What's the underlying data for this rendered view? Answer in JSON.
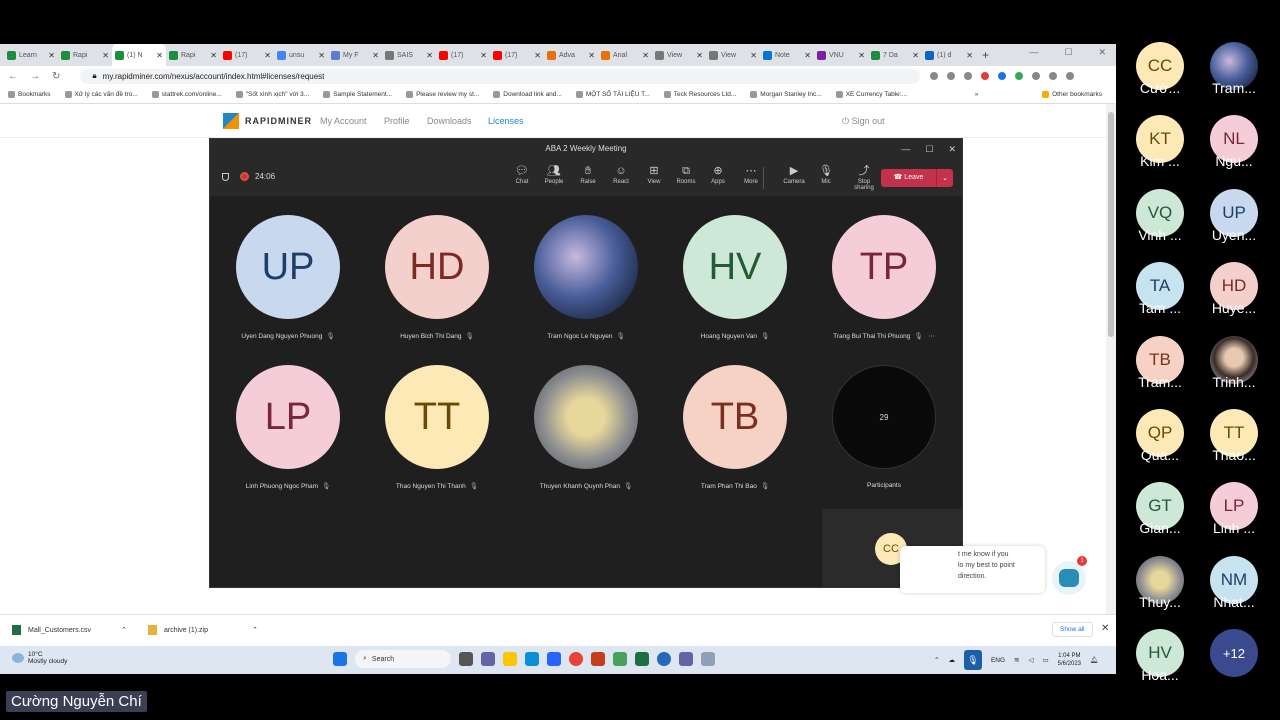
{
  "browser": {
    "tabs": [
      {
        "label": "Learn",
        "icon": "green"
      },
      {
        "label": "Rapi",
        "icon": "green"
      },
      {
        "label": "(1) N",
        "icon": "green",
        "active": true
      },
      {
        "label": "Rapi",
        "icon": "green"
      },
      {
        "label": "(17)",
        "icon": "youtube"
      },
      {
        "label": "unsu",
        "icon": "google"
      },
      {
        "label": "My F",
        "icon": "blue"
      },
      {
        "label": "SAIS",
        "icon": "gray"
      },
      {
        "label": "(17)",
        "icon": "youtube"
      },
      {
        "label": "(17)",
        "icon": "youtube"
      },
      {
        "label": "Adva",
        "icon": "orange"
      },
      {
        "label": "Anal",
        "icon": "orange"
      },
      {
        "label": "View",
        "icon": "gray"
      },
      {
        "label": "View",
        "icon": "gray"
      },
      {
        "label": "Note",
        "icon": "cloud"
      },
      {
        "label": "VNU",
        "icon": "purple"
      },
      {
        "label": "7 Da",
        "icon": "green"
      },
      {
        "label": "(1) d",
        "icon": "linkedin"
      }
    ],
    "new_tab": "+",
    "url": "my.rapidminer.com/nexus/account/index.html#licenses/request",
    "bookmarks": [
      "Bookmarks",
      "Xử lý các vấn đề tro...",
      "stattrek.com/online...",
      "\"Sốt xình xịch\" với 3...",
      "Sample Statement...",
      "Please review my st...",
      "Download link and...",
      "MỘT SỐ TÀI LIỆU T...",
      "Teck Resources Ltd...",
      "Morgan Stanley Inc...",
      "XE Currency Table:..."
    ],
    "more": "»",
    "other_bookmarks": "Other bookmarks"
  },
  "site": {
    "logo": "RAPIDMINER",
    "nav": [
      "My Account",
      "Profile",
      "Downloads",
      "Licenses"
    ],
    "signout": "Sign out"
  },
  "meeting": {
    "title": "ABA 2 Weekly Meeting",
    "timer": "24:06",
    "tools": [
      "Chat",
      "People",
      "Raise",
      "React",
      "View",
      "Rooms",
      "Apps",
      "More",
      "Camera",
      "Mic",
      "Stop sharing"
    ],
    "leave": "Leave",
    "participants": [
      {
        "initials": "UP",
        "name": "Uyen Dang Nguyen Phuong",
        "bg": "#c8d8ee",
        "fg": "#1e3e6a"
      },
      {
        "initials": "HD",
        "name": "Huyen Bich Thi Dang",
        "bg": "#f3d0cb",
        "fg": "#7a2a22"
      },
      {
        "initials": "",
        "name": "Tram Ngoc Le Nguyen",
        "bg": "photo-blue",
        "fg": "#fff"
      },
      {
        "initials": "HV",
        "name": "Hoang Nguyen Van",
        "bg": "#cde8d6",
        "fg": "#245a34"
      },
      {
        "initials": "TP",
        "name": "Trang Bui Thai Thi Phuong",
        "bg": "#f5cdd8",
        "fg": "#7a2540"
      },
      {
        "initials": "LP",
        "name": "Linh Phuong Ngoc Pham",
        "bg": "#f5cdd8",
        "fg": "#7a2540"
      },
      {
        "initials": "TT",
        "name": "Thao Nguyen Thi Thanh",
        "bg": "#fde9b6",
        "fg": "#6b4a00"
      },
      {
        "initials": "",
        "name": "Thuyen Khanh Quynh Phan",
        "bg": "photo-gray",
        "fg": "#fff"
      },
      {
        "initials": "TB",
        "name": "Tram Phan Thi Bao",
        "bg": "#f6d2c4",
        "fg": "#7a3020"
      },
      {
        "initials": "29",
        "name": "Participants",
        "bg": "#0a0a0a",
        "fg": "#ddd"
      }
    ],
    "self_initials": "CC"
  },
  "chatbot": {
    "line1": "t me know if you",
    "line2": "lo my best to point",
    "line3": "direction.",
    "badge": "1"
  },
  "downloads": {
    "items": [
      "Mall_Customers.csv",
      "archive (1).zip"
    ],
    "show_all": "Show all",
    "close": "✕"
  },
  "taskbar": {
    "temp": "10°C",
    "weather": "Mostly cloudy",
    "search": "Search",
    "lang": "ENG",
    "time": "1:04 PM",
    "date": "5/6/2023"
  },
  "gallery": [
    {
      "initials": "CC",
      "name": "Cườ...",
      "bg": "#fde9b6",
      "fg": "#6b4a00"
    },
    {
      "initials": "",
      "name": "Tram...",
      "bg": "photo-blue",
      "fg": "#fff"
    },
    {
      "initials": "KT",
      "name": "Kim ...",
      "bg": "#fde9b6",
      "fg": "#6b4a00"
    },
    {
      "initials": "NL",
      "name": "Ngu...",
      "bg": "#f5cdd8",
      "fg": "#7a2540"
    },
    {
      "initials": "VQ",
      "name": "Vinh ...",
      "bg": "#cde8d6",
      "fg": "#245a34"
    },
    {
      "initials": "UP",
      "name": "Uyen...",
      "bg": "#c8d8ee",
      "fg": "#1e3e6a"
    },
    {
      "initials": "TA",
      "name": "Tam ...",
      "bg": "#c8e3f0",
      "fg": "#1e3e6a"
    },
    {
      "initials": "HD",
      "name": "Huye...",
      "bg": "#f3d0cb",
      "fg": "#7a2a22"
    },
    {
      "initials": "TB",
      "name": "Tram...",
      "bg": "#f6d2c4",
      "fg": "#7a3020"
    },
    {
      "initials": "",
      "name": "Trinh...",
      "bg": "photo-face",
      "fg": "#fff"
    },
    {
      "initials": "QP",
      "name": "Qua...",
      "bg": "#fde9b6",
      "fg": "#6b4a00"
    },
    {
      "initials": "TT",
      "name": "Thao...",
      "bg": "#fde9b6",
      "fg": "#6b4a00"
    },
    {
      "initials": "GT",
      "name": "Gian...",
      "bg": "#cde8d6",
      "fg": "#245a34"
    },
    {
      "initials": "LP",
      "name": "Linh ...",
      "bg": "#f5cdd8",
      "fg": "#7a2540"
    },
    {
      "initials": "",
      "name": "Thuy...",
      "bg": "photo-gray",
      "fg": "#fff"
    },
    {
      "initials": "NM",
      "name": "Nhat...",
      "bg": "#c8e3f0",
      "fg": "#1e3e6a"
    },
    {
      "initials": "HV",
      "name": "Hoa...",
      "bg": "#cde8d6",
      "fg": "#245a34"
    },
    {
      "initials": "+12",
      "name": "",
      "bg": "#3b4a8f",
      "fg": "#fff"
    }
  ],
  "presenter_name": "Cường Nguyễn Chí"
}
